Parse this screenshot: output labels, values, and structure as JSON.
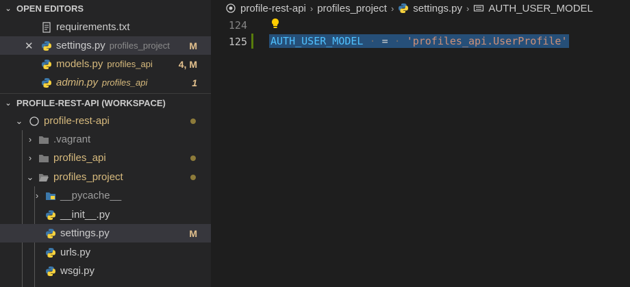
{
  "open_editors": {
    "title": "OPEN EDITORS",
    "items": [
      {
        "name": "requirements.txt",
        "desc": "",
        "badge": ""
      },
      {
        "name": "settings.py",
        "desc": "profiles_project",
        "badge": "M"
      },
      {
        "name": "models.py",
        "desc": "profiles_api",
        "badge": "4, M"
      },
      {
        "name": "admin.py",
        "desc": "profiles_api",
        "badge": "1"
      }
    ]
  },
  "workspace": {
    "title": "PROFILE-REST-API (WORKSPACE)",
    "items": [
      {
        "name": "profile-rest-api",
        "badge": ""
      },
      {
        "name": ".vagrant",
        "badge": ""
      },
      {
        "name": "profiles_api",
        "badge": ""
      },
      {
        "name": "profiles_project",
        "badge": ""
      },
      {
        "name": "__pycache__",
        "badge": ""
      },
      {
        "name": "__init__.py",
        "badge": ""
      },
      {
        "name": "settings.py",
        "badge": "M"
      },
      {
        "name": "urls.py",
        "badge": ""
      },
      {
        "name": "wsgi.py",
        "badge": ""
      }
    ]
  },
  "breadcrumbs": [
    "profile-rest-api",
    "profiles_project",
    "settings.py",
    "AUTH_USER_MODEL"
  ],
  "editor": {
    "lines": [
      {
        "number": "124"
      },
      {
        "number": "125"
      }
    ],
    "code": {
      "name": "AUTH_USER_MODEL",
      "op": "=",
      "value": "'profiles_api.UserProfile'"
    }
  },
  "colors": {
    "modified": "#e2c08d",
    "string": "#ce9178",
    "constant": "#4fc1ff",
    "selection": "#264f78"
  }
}
